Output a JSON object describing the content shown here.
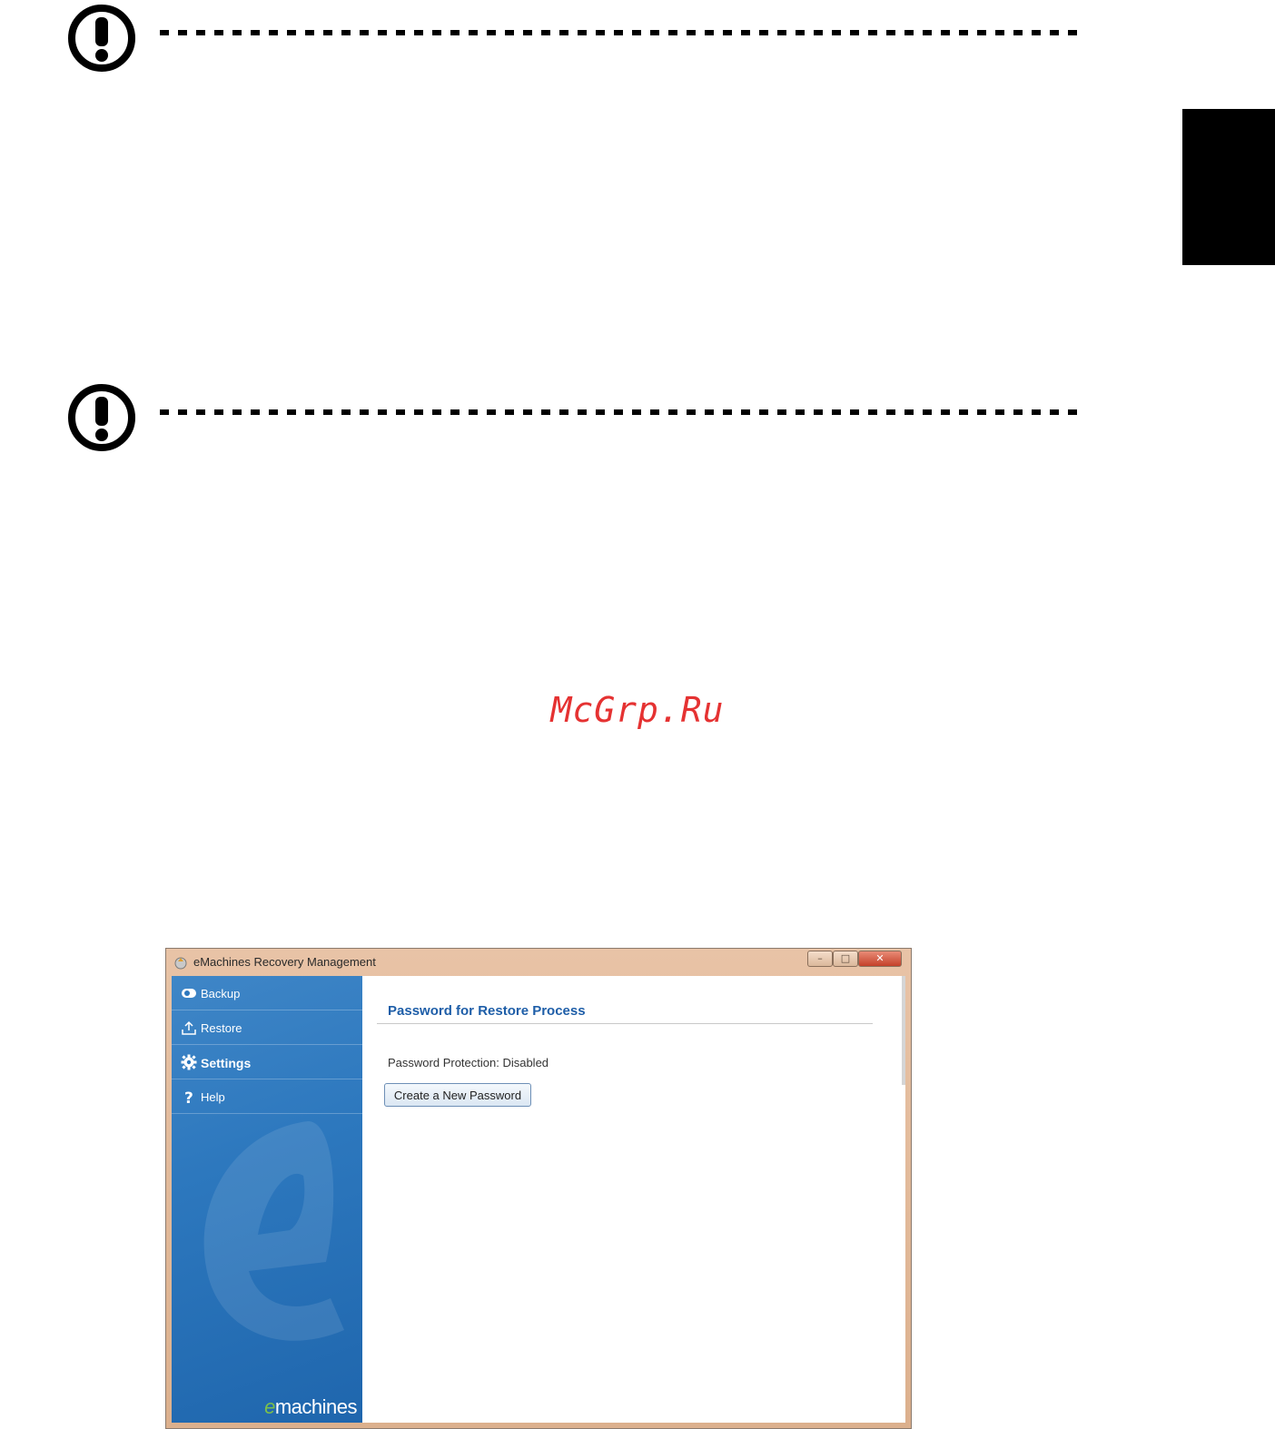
{
  "watermark": "McGrp.Ru",
  "window": {
    "title": "eMachines Recovery Management",
    "minimize_glyph": "–",
    "maximize_glyph": "□",
    "close_glyph": "✕"
  },
  "sidebar": {
    "items": [
      {
        "label": "Backup",
        "icon": "backup-icon"
      },
      {
        "label": "Restore",
        "icon": "restore-icon"
      },
      {
        "label": "Settings",
        "icon": "gear-icon"
      },
      {
        "label": "Help",
        "icon": "question-icon"
      }
    ],
    "active_item": "Settings",
    "brand_prefix": "e",
    "brand_suffix": "machines"
  },
  "panel": {
    "heading": "Password for Restore Process",
    "status": "Password Protection: Disabled",
    "create_button_label": "Create a New Password"
  },
  "colors": {
    "watermark": "#e53232",
    "sidebar_blue": "#2d78be",
    "heading_blue": "#1e5ea8",
    "titlebar": "#e8c3a6"
  }
}
